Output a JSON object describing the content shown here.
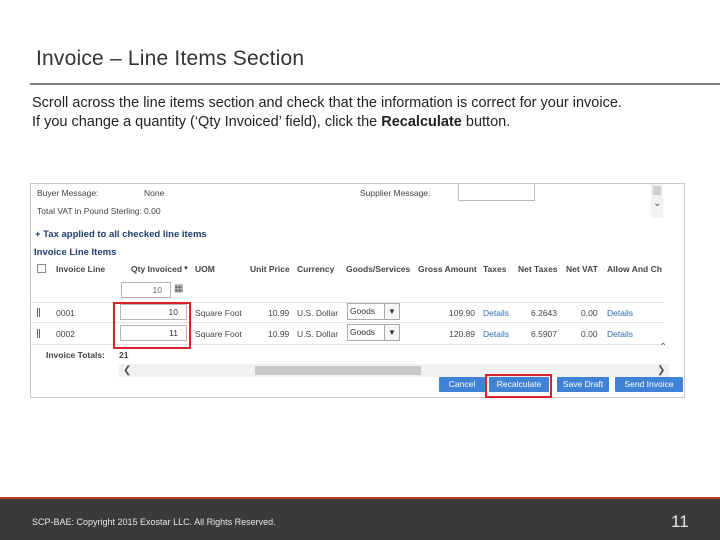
{
  "slide": {
    "title": "Invoice – Line Items Section",
    "body_line1": "Scroll across the line items section and check that the information is correct for your invoice.",
    "body_line2_pre": "If you change a quantity (‘Qty Invoiced’ field), click the ",
    "body_line2_bold": "Recalculate",
    "body_line2_post": " button."
  },
  "screenshot": {
    "buyer_message_label": "Buyer Message:",
    "buyer_message_value": "None",
    "supplier_message_label": "Supplier Message:",
    "total_vat_label": "Total VAT in Pound Sterling:",
    "total_vat_value": "0.00",
    "tax_note": "+ Tax applied to all checked line items",
    "section_title": "Invoice Line Items",
    "columns": [
      "Invoice Line",
      "Qty Invoiced *",
      "UOM",
      "Unit Price",
      "Currency",
      "Goods/Services",
      "Gross Amount",
      "Taxes",
      "Net Taxes",
      "Net VAT",
      "Allow And Ch"
    ],
    "qty_header_input": "10",
    "rows": [
      {
        "line": "0001",
        "qty": "10",
        "uom": "Square Foot",
        "unit_price": "10.99",
        "currency": "U.S. Dollar",
        "goods": "Goods",
        "gross": "109.90",
        "taxes": "Details",
        "net_taxes": "6.2643",
        "net_vat": "0.00",
        "allow": "Details"
      },
      {
        "line": "0002",
        "qty": "11",
        "uom": "Square Foot",
        "unit_price": "10.99",
        "currency": "U.S. Dollar",
        "goods": "Goods",
        "gross": "120.89",
        "taxes": "Details",
        "net_taxes": "6.5907",
        "net_vat": "0.00",
        "allow": "Details"
      }
    ],
    "invoice_totals_label": "Invoice Totals:",
    "invoice_totals_value": "21",
    "buttons": {
      "cancel": "Cancel",
      "recalculate": "Recalculate",
      "save_draft": "Save Draft",
      "send_invoice": "Send Invoice"
    },
    "button_color": "#3f82d6",
    "highlight_color": "#d9232a"
  },
  "footer": {
    "copyright": "SCP-BAE: Copyright 2015 Exostar LLC. All Rights Reserved.",
    "page_number": "11"
  }
}
